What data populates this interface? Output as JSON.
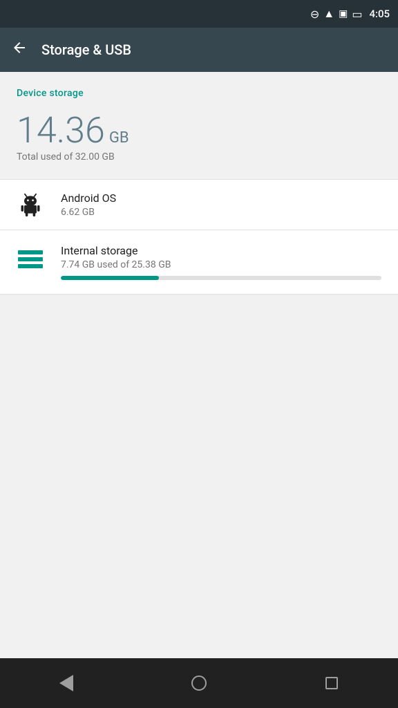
{
  "statusBar": {
    "time": "4:05"
  },
  "appBar": {
    "title": "Storage & USB",
    "backLabel": "←"
  },
  "deviceStorage": {
    "sectionLabel": "Device storage",
    "usedAmount": "14.36",
    "usedUnit": "GB",
    "totalText": "Total used of 32.00 GB"
  },
  "storageItems": [
    {
      "id": "android-os",
      "title": "Android OS",
      "subtitle": "6.62 GB",
      "iconType": "android",
      "hasProgress": false
    },
    {
      "id": "internal-storage",
      "title": "Internal storage",
      "subtitle": "7.74 GB used of 25.38 GB",
      "iconType": "internal",
      "hasProgress": true,
      "progressPercent": 30.5
    }
  ],
  "navBar": {
    "backLabel": "Back",
    "homeLabel": "Home",
    "recentLabel": "Recent"
  }
}
